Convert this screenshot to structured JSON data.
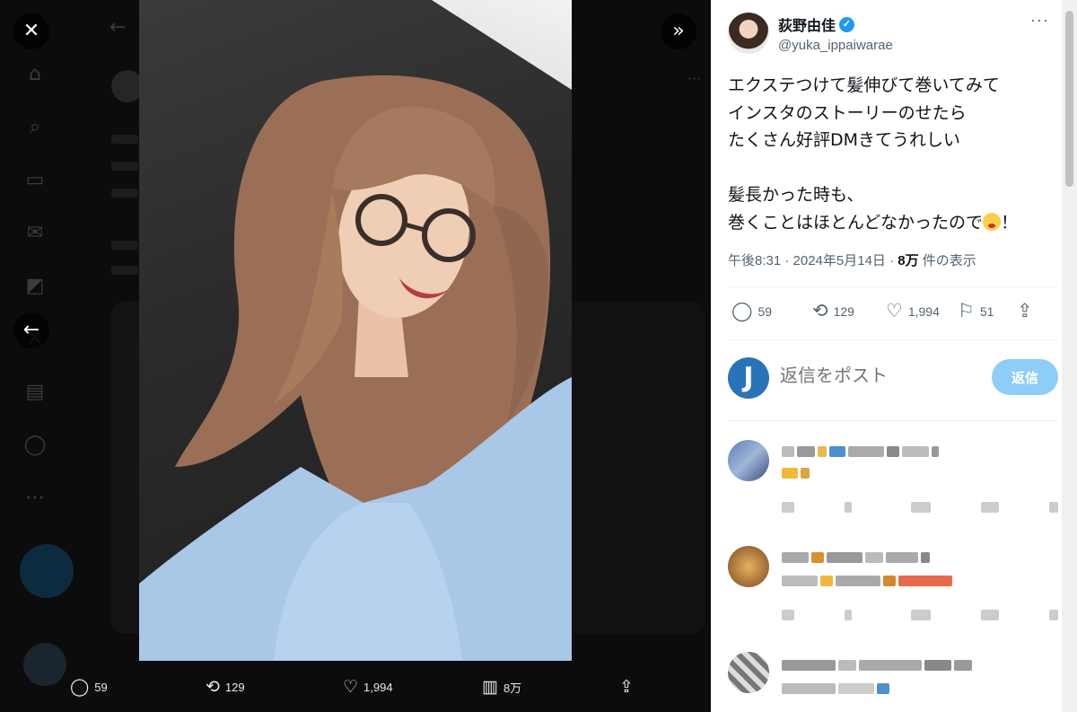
{
  "viewer": {
    "close_icon": "close-icon",
    "prev_icon": "arrow-left-icon",
    "expand_icon": "double-chevron-right-icon",
    "photo_alt": "selfie"
  },
  "media_stats": {
    "replies": "59",
    "reposts": "129",
    "likes": "1,994",
    "views": "8万"
  },
  "author": {
    "name": "荻野由佳",
    "handle": "@yuka_ippaiwarae",
    "verified": true,
    "more_label": "···"
  },
  "tweet": {
    "text": "エクステつけて髪伸びて巻いてみて\nインスタのストーリーのせたら\nたくさん好評DMきてうれしい\n\n髪長かった時も、\n巻くことはほとんどなかったので",
    "text_end": "！",
    "time": "午後8:31 · 2024年5月14日 · ",
    "views_count": "8万",
    "views_label": " 件の表示"
  },
  "actions": {
    "replies": "59",
    "reposts": "129",
    "likes": "1,994",
    "bookmarks": "51"
  },
  "reply_box": {
    "avatar_letter": "J",
    "placeholder": "返信をポスト",
    "button_label": "返信"
  },
  "colors": {
    "accent": "#1d9bf0",
    "reply_button": "#8ecdf8",
    "panel_bg": "#ffffff",
    "overlay_bg": "#000000"
  }
}
